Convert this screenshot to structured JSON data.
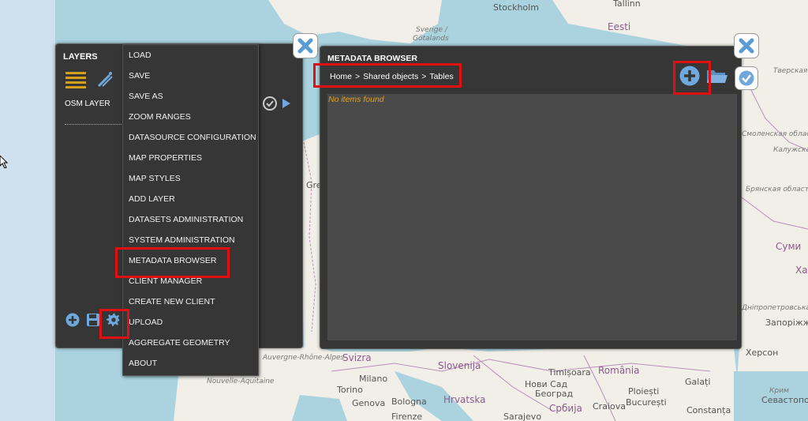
{
  "map": {
    "labels": {
      "stockholm": "Stockholm",
      "tallinn": "Tallinn",
      "eesti": "Eesti",
      "sverige": "Sverige /",
      "gotalands": "Götalands",
      "milano": "Milano",
      "genova": "Genova",
      "bologna": "Bologna",
      "firenze": "Firenze",
      "torino": "Torino",
      "hrvatska": "Hrvatska",
      "slovenija": "Slovenija",
      "svizra": "Svizra",
      "romania": "România",
      "timisoara": "Timișoara",
      "novi_sad": "Нови Сад",
      "beograd": "Београд",
      "srbija": "Србија",
      "sarajevo": "Sarajevo",
      "craiova": "Craiova",
      "ploiesti": "Ploiești",
      "bucuresti": "București",
      "galati": "Galați",
      "constanta": "Constanța",
      "sumy": "Суми",
      "kherson": "Херсон",
      "sevastopol": "Севастополь",
      "krym": "Крим",
      "dnipro": "Дніпропетровська область",
      "zaporizhzhia": "Запоріжж",
      "auvergne": "Auvergne-Rhône-Alpes",
      "nouvelle": "Nouvelle-Aquitaine",
      "bryansk": "Брянская область",
      "kaluga": "Калужская область",
      "smolensk": "Смоленская область",
      "tver": "Тверская область",
      "khar": "Хар",
      "gre": "Gre"
    }
  },
  "layers_panel": {
    "title": "LAYERS",
    "layer_name": "OSM LAYER"
  },
  "menu": {
    "items": [
      "LOAD",
      "SAVE",
      "SAVE AS",
      "ZOOM RANGES",
      "DATASOURCE CONFIGURATION",
      "MAP PROPERTIES",
      "MAP STYLES",
      "ADD LAYER",
      "DATASETS ADMINISTRATION",
      "SYSTEM ADMINISTRATION",
      "METADATA BROWSER",
      "CLIENT MANAGER",
      "CREATE NEW CLIENT",
      "UPLOAD",
      "AGGREGATE GEOMETRY",
      "ABOUT"
    ]
  },
  "metadata_browser": {
    "title": "METADATA BROWSER",
    "breadcrumb": {
      "home": "Home",
      "sep1": ">",
      "shared": "Shared objects",
      "sep2": ">",
      "tables": "Tables"
    },
    "empty_message": "No items found"
  },
  "colors": {
    "panel_bg": "#363636",
    "content_bg": "#4a4a4a",
    "highlight": "#e01010",
    "accent_blue": "#6fa8dc",
    "empty_text": "#e0a020",
    "layer_icon_gold": "#d4a017"
  }
}
